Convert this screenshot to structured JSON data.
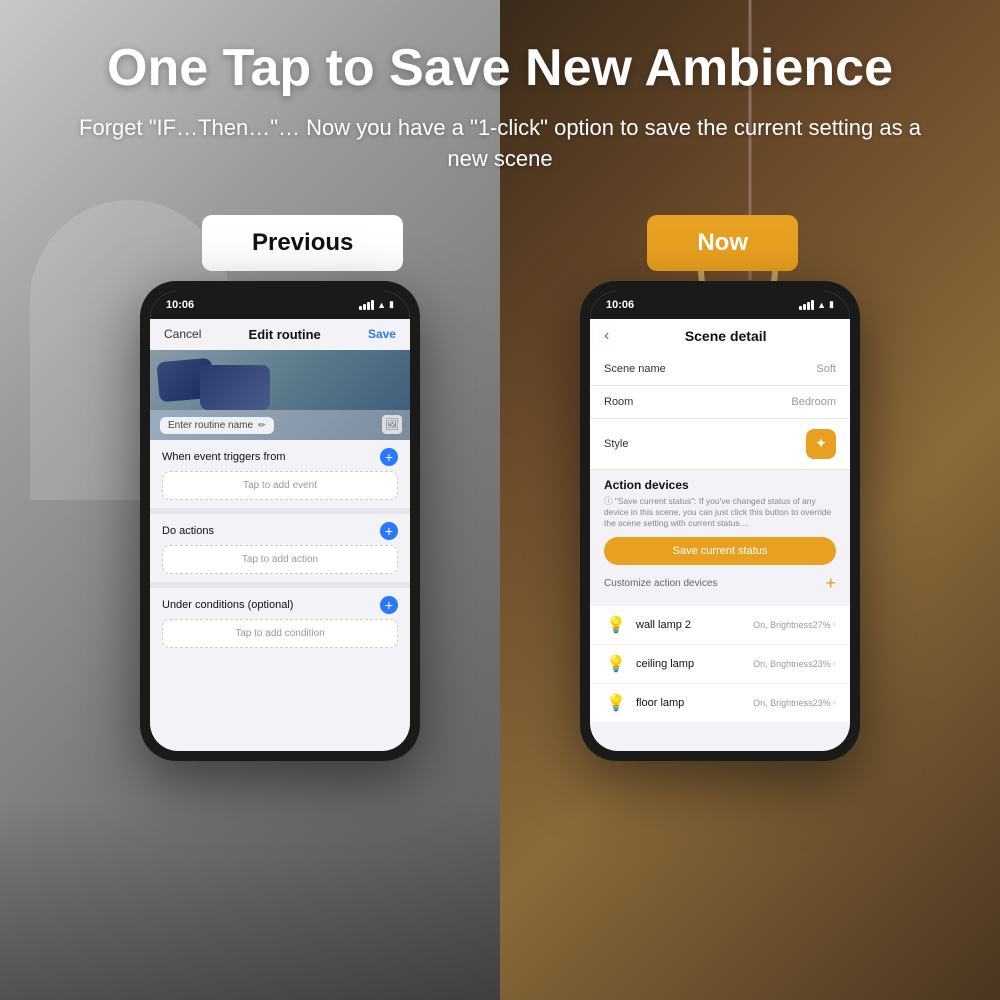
{
  "background": {
    "left_color_start": "#c8c8c8",
    "left_color_end": "#5a5a5a",
    "right_color_start": "#3a2a1a",
    "right_color_end": "#4a3520"
  },
  "header": {
    "main_title": "One Tap to Save New Ambience",
    "subtitle": "Forget \"IF…Then…\"… Now you have a \"1-click\" option to save the current setting as a new scene"
  },
  "labels": {
    "previous": "Previous",
    "now": "Now"
  },
  "phone_left": {
    "time": "10:06",
    "screen_title": "Edit routine",
    "cancel": "Cancel",
    "save": "Save",
    "name_placeholder": "Enter routine name",
    "section1_label": "When event triggers from",
    "tap_add_event": "Tap to add event",
    "section2_label": "Do actions",
    "tap_add_action": "Tap to add action",
    "section3_label": "Under conditions (optional)",
    "tap_add_condition": "Tap to add condition"
  },
  "phone_right": {
    "time": "10:06",
    "screen_title": "Scene detail",
    "scene_name_label": "Scene name",
    "scene_name_value": "Soft",
    "room_label": "Room",
    "room_value": "Bedroom",
    "style_label": "Style",
    "action_devices_title": "Action devices",
    "save_note": "\"Save current status\": If you've changed status of any device in this scene, you can just click this button to override the scene setting with current status....",
    "save_status_btn": "Save current status",
    "customize_label": "Customize action devices",
    "devices": [
      {
        "name": "wall lamp 2",
        "status": "On, Brightness27%"
      },
      {
        "name": "ceiling lamp",
        "status": "On, Brightness23%"
      },
      {
        "name": "floor lamp",
        "status": "On, Brightness23%"
      }
    ]
  }
}
